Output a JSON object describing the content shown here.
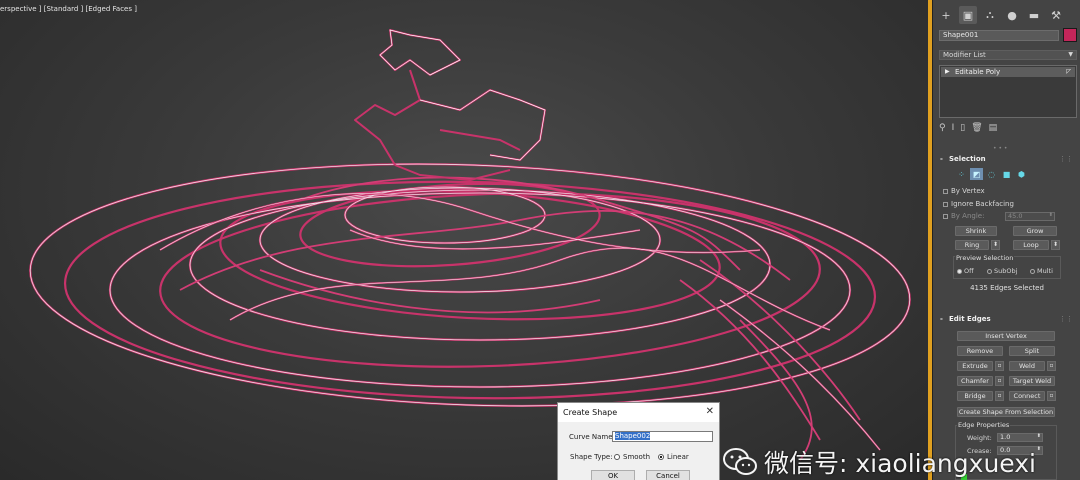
{
  "viewport": {
    "label": "erspective ] [Standard ] [Edged Faces ]"
  },
  "panel": {
    "tabs": [
      "+",
      "▣",
      "⛬",
      "●",
      "▬",
      "🔧"
    ],
    "object_name": "Shape001",
    "object_color": "#c4265a",
    "modifier_list": "Modifier List",
    "stack_item": "Editable Poly",
    "selection": {
      "title": "Selection",
      "by_vertex": "By Vertex",
      "ignore_backfacing": "Ignore Backfacing",
      "by_angle": "By Angle:",
      "by_angle_value": "45.0",
      "shrink": "Shrink",
      "grow": "Grow",
      "ring": "Ring",
      "loop": "Loop",
      "preview_title": "Preview Selection",
      "off": "Off",
      "subobj": "SubObj",
      "multi": "Multi",
      "status": "4135 Edges Selected"
    },
    "edit_edges": {
      "title": "Edit Edges",
      "insert_vertex": "Insert Vertex",
      "remove": "Remove",
      "split": "Split",
      "extrude": "Extrude",
      "weld": "Weld",
      "chamfer": "Chamfer",
      "target_weld": "Target Weld",
      "bridge": "Bridge",
      "connect": "Connect",
      "create_shape": "Create Shape From Selection",
      "edge_props": "Edge Properties",
      "weight_label": "Weight:",
      "weight_value": "1.0",
      "crease_label": "Crease:",
      "crease_value": "0.0"
    }
  },
  "dialog": {
    "title": "Create Shape",
    "curve_name_label": "Curve Name:",
    "curve_name_value": "Shape002",
    "shape_type_label": "Shape Type:",
    "smooth": "Smooth",
    "linear": "Linear",
    "ok": "OK",
    "cancel": "Cancel"
  },
  "watermark": {
    "text": "微信号: xiaoliangxuexi"
  }
}
